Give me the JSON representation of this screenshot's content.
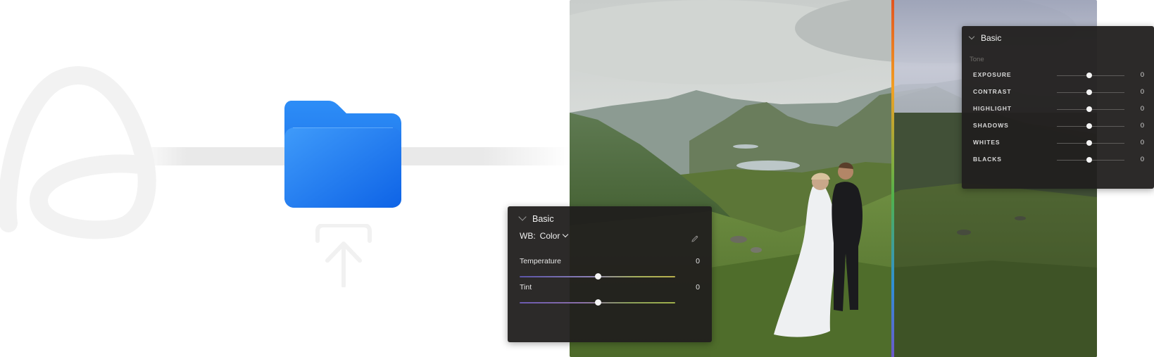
{
  "canvas": {
    "background": "#ffffff"
  },
  "folder": {
    "icon": "folder-icon",
    "color": "#1a7cf0"
  },
  "upload": {
    "icon": "upload-arrow-icon"
  },
  "logo": {
    "icon": "brand-logo-icon"
  },
  "photo": {
    "subject": "wedding-couple-landscape"
  },
  "split_line": {
    "colors": [
      "#e2541f",
      "#f2a023",
      "#51b24c",
      "#2f8fd6",
      "#6c58c9"
    ]
  },
  "wb_panel": {
    "title": "Basic",
    "wb_label": "WB:",
    "wb_value": "Color",
    "eyedropper_icon": "eyedropper-icon",
    "sliders": [
      {
        "label": "Temperature",
        "value": "0",
        "position": 0.5
      },
      {
        "label": "Tint",
        "value": "0",
        "position": 0.5
      }
    ]
  },
  "tone_panel": {
    "title": "Basic",
    "section": "Tone",
    "sliders": [
      {
        "label": "EXPOSURE",
        "value": "0",
        "position": 0.5
      },
      {
        "label": "CONTRAST",
        "value": "0",
        "position": 0.5
      },
      {
        "label": "HIGHLIGHT",
        "value": "0",
        "position": 0.5
      },
      {
        "label": "SHADOWS",
        "value": "0",
        "position": 0.5
      },
      {
        "label": "WHITES",
        "value": "0",
        "position": 0.5
      },
      {
        "label": "BLACKS",
        "value": "0",
        "position": 0.5
      }
    ]
  }
}
